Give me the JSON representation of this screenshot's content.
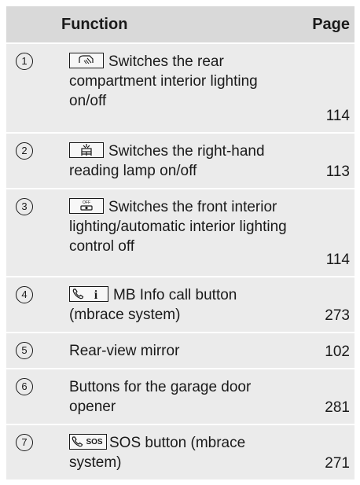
{
  "header": {
    "function": "Function",
    "page": "Page"
  },
  "rows": [
    {
      "num": "1",
      "icon": "rear-interior-light-icon",
      "text": "Switches the rear compartment interior lighting on/off",
      "page": "114"
    },
    {
      "num": "2",
      "icon": "reading-lamp-icon",
      "text": "Switches the right-hand reading lamp on/off",
      "page": "113"
    },
    {
      "num": "3",
      "icon": "front-light-off-icon",
      "icon_text": "OFF",
      "text": "Switches the front interior lighting/automatic interior lighting control off",
      "page": "114"
    },
    {
      "num": "4",
      "icon": "phone-info-icon",
      "icon_text": "i",
      "text": "MB Info call button (mbrace system)",
      "page": "273"
    },
    {
      "num": "5",
      "text": "Rear-view mirror",
      "page": "102"
    },
    {
      "num": "6",
      "text": "Buttons for the garage door opener",
      "page": "281"
    },
    {
      "num": "7",
      "icon": "phone-sos-icon",
      "icon_text": "SOS",
      "text": "SOS button (mbrace system)",
      "page": "271"
    }
  ],
  "colors": {
    "header_bg": "#d9d9d9",
    "row_bg": "#ebebeb",
    "text": "#1a1a1a"
  }
}
